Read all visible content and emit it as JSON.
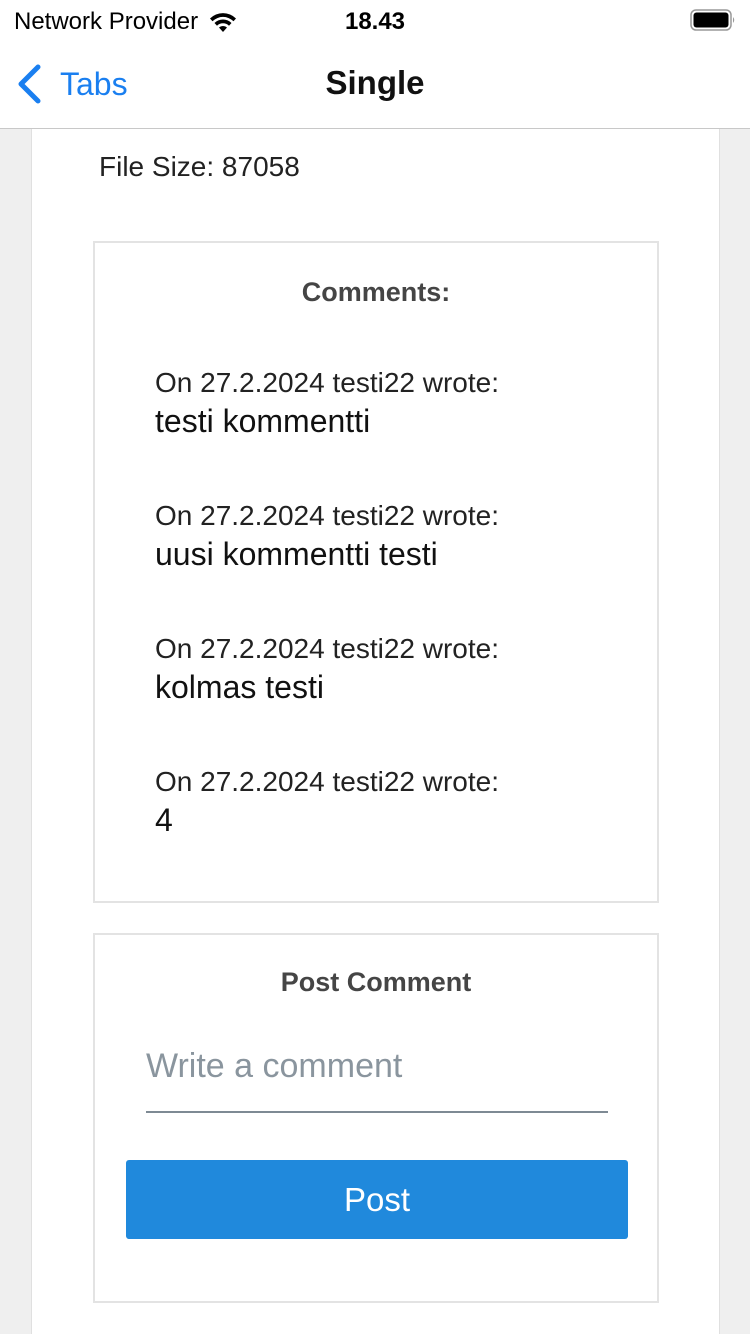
{
  "status_bar": {
    "carrier": "Network Provider",
    "time": "18.43"
  },
  "nav": {
    "back_label": "Tabs",
    "title": "Single"
  },
  "file": {
    "size_text": "File Size: 87058"
  },
  "comments": {
    "title": "Comments:",
    "items": [
      {
        "meta": "On 27.2.2024 testi22 wrote:",
        "text": "testi kommentti"
      },
      {
        "meta": "On 27.2.2024 testi22 wrote:",
        "text": "uusi kommentti testi"
      },
      {
        "meta": "On 27.2.2024 testi22 wrote:",
        "text": "kolmas testi"
      },
      {
        "meta": "On 27.2.2024 testi22 wrote:",
        "text": "4"
      }
    ]
  },
  "post_comment": {
    "title": "Post Comment",
    "input_placeholder": "Write a comment",
    "input_value": "",
    "button_label": "Post"
  },
  "colors": {
    "accent": "#1a7ff0",
    "button": "#2089dc"
  }
}
